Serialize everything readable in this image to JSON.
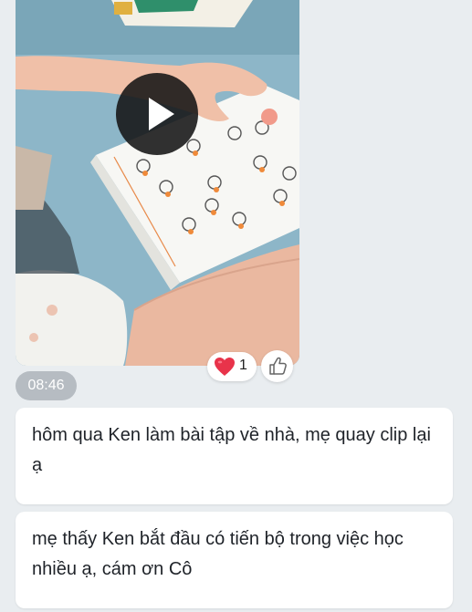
{
  "video": {
    "thumbnail_icon": "play-icon"
  },
  "reactions": {
    "heart_icon": "heart-icon",
    "heart_count": "1",
    "like_icon": "thumbs-up-icon"
  },
  "message_time": "08:46",
  "messages": [
    {
      "text": "hôm qua Ken làm bài tập về nhà, mẹ quay clip lại ạ"
    },
    {
      "text": "mẹ thấy Ken bắt đầu có tiến bộ trong việc học nhiều ạ, cám ơn Cô"
    }
  ],
  "colors": {
    "background": "#e9edf0",
    "bubble": "#ffffff",
    "time_badge": "#b6bcc2",
    "heart": "#e8334a"
  }
}
